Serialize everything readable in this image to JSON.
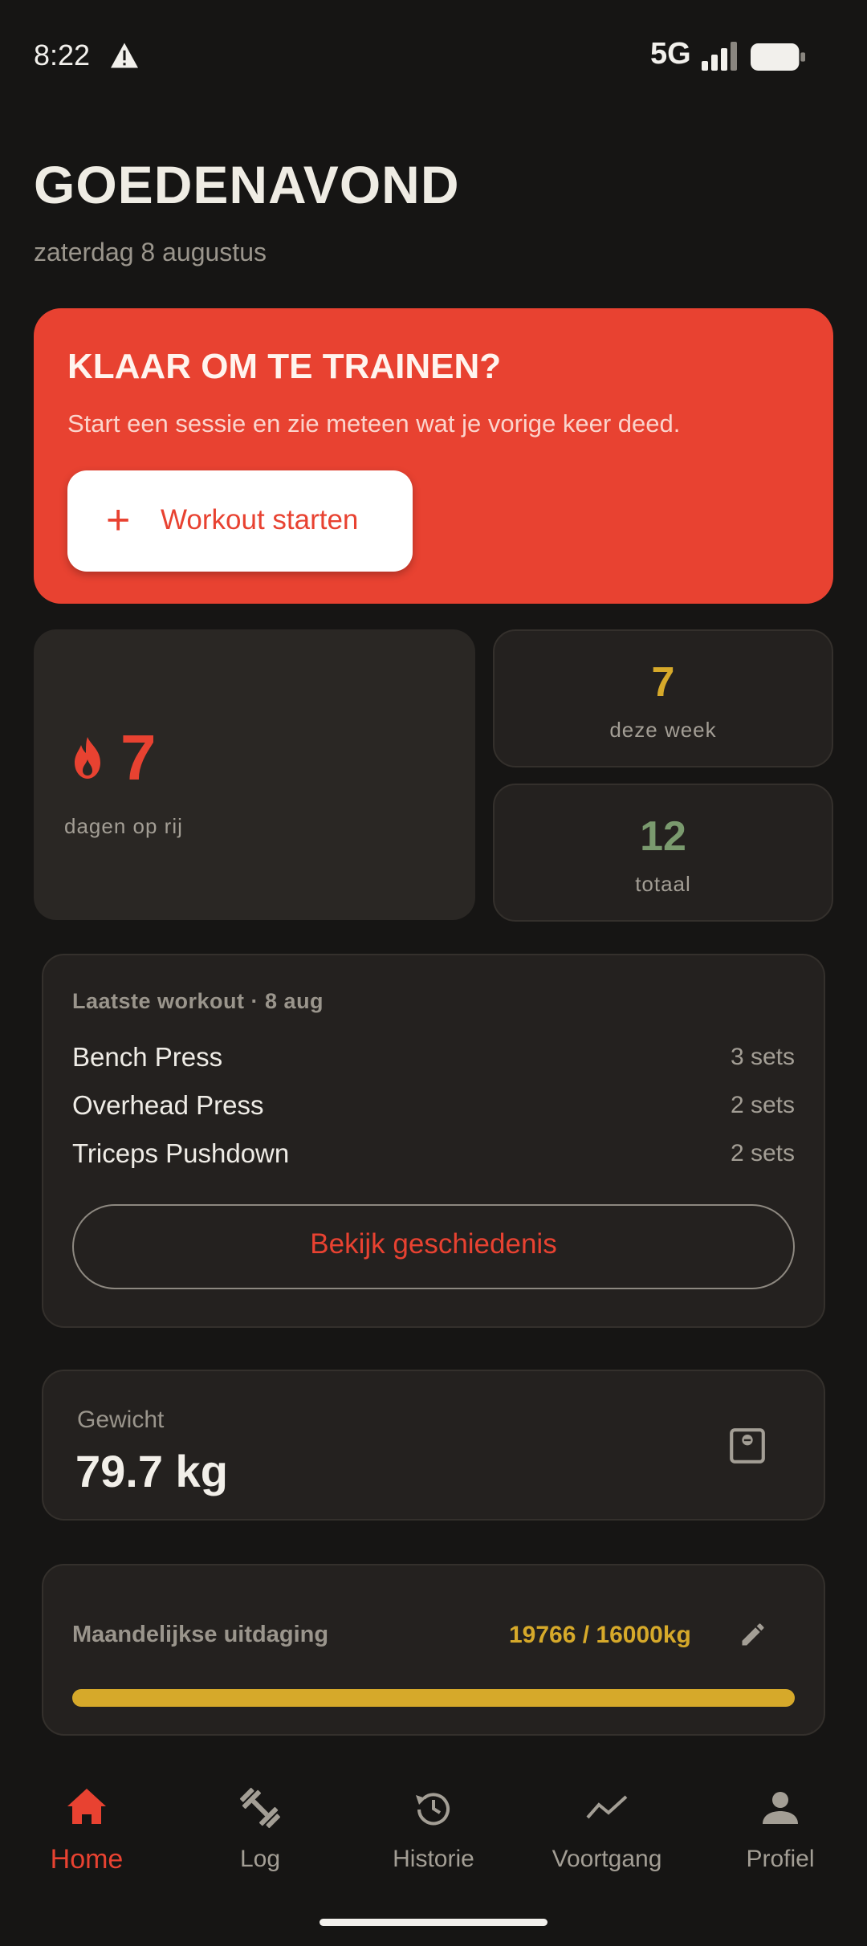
{
  "status_bar": {
    "time": "8:22",
    "network": "5G"
  },
  "header": {
    "greeting": "GOEDENAVOND",
    "date": "zaterdag 8 augustus"
  },
  "hero": {
    "title": "KLAAR OM TE TRAINEN?",
    "subtitle": "Start een sessie en zie meteen wat je vorige keer deed.",
    "button_icon": "+",
    "button_label": "Workout starten"
  },
  "stats": {
    "streak": {
      "value": "7",
      "label": "dagen op rij",
      "icon": "flame-icon"
    },
    "week": {
      "value": "7",
      "label": "deze week"
    },
    "total": {
      "value": "12",
      "label": "totaal"
    }
  },
  "last_workout": {
    "title": "Laatste workout · 8 aug",
    "exercises": [
      {
        "name": "Bench Press",
        "sets": "3 sets"
      },
      {
        "name": "Overhead Press",
        "sets": "2 sets"
      },
      {
        "name": "Triceps Pushdown",
        "sets": "2 sets"
      }
    ],
    "history_button": "Bekijk geschiedenis"
  },
  "weight": {
    "label": "Gewicht",
    "value": "79.7 kg",
    "icon": "scale-icon"
  },
  "challenge": {
    "title": "Maandelijkse uitdaging",
    "value": "19766 / 16000kg",
    "progress": 1.0,
    "icon": "edit-icon"
  },
  "nav": {
    "items": [
      {
        "label": "Home",
        "icon": "home-icon",
        "active": true
      },
      {
        "label": "Log",
        "icon": "dumbbell-icon",
        "active": false
      },
      {
        "label": "Historie",
        "icon": "history-icon",
        "active": false
      },
      {
        "label": "Voortgang",
        "icon": "trending-icon",
        "active": false
      },
      {
        "label": "Profiel",
        "icon": "person-icon",
        "active": false
      }
    ]
  },
  "colors": {
    "accent": "#e84231",
    "gold": "#d6a92a",
    "green": "#7a9a6e",
    "background": "#161514",
    "card": "#24211f"
  }
}
